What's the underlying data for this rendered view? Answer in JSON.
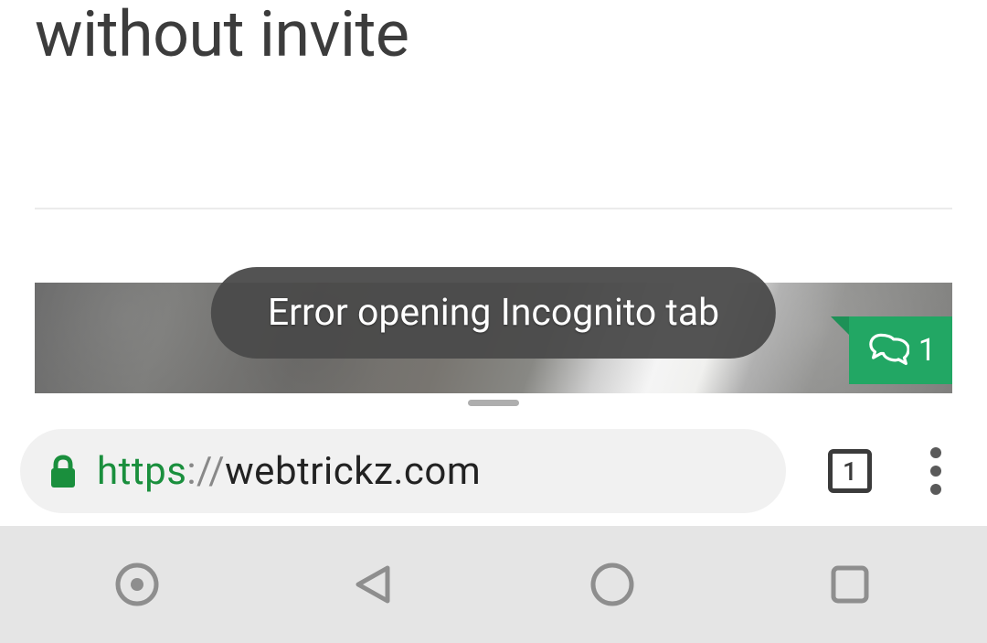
{
  "page": {
    "title_fragment": "without invite"
  },
  "toast": {
    "message": "Error opening Incognito tab"
  },
  "comments": {
    "count": "1"
  },
  "browser": {
    "url_scheme": "https",
    "url_sep": "://",
    "url_host": "webtrickz.com",
    "tab_count": "1"
  },
  "colors": {
    "accent_green": "#22a764",
    "lock_green": "#1a8f3d"
  }
}
